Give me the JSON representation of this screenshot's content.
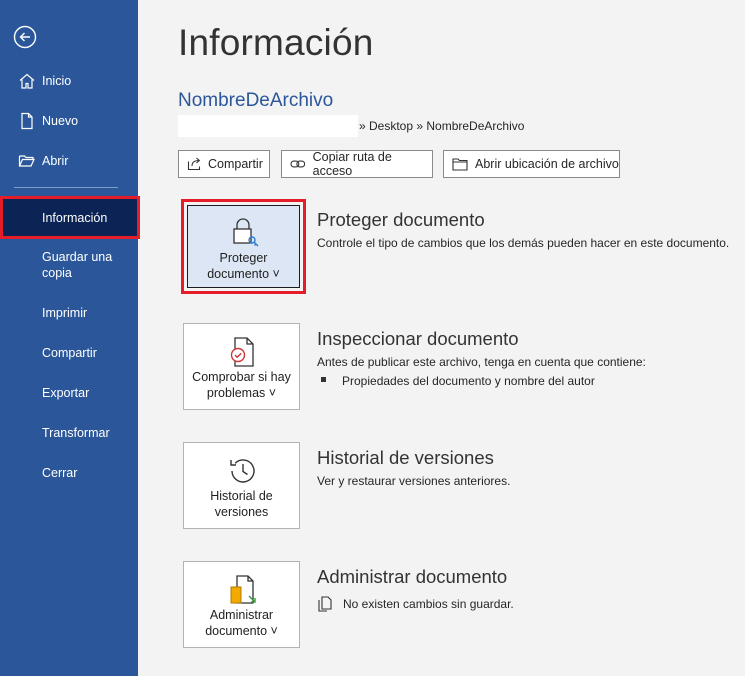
{
  "sidebar": {
    "items": [
      {
        "label": "Inicio",
        "icon": "home-icon"
      },
      {
        "label": "Nuevo",
        "icon": "new-document-icon"
      },
      {
        "label": "Abrir",
        "icon": "open-folder-icon"
      },
      {
        "label": "Información",
        "active": true
      },
      {
        "label": "Guardar una copia"
      },
      {
        "label": "Imprimir"
      },
      {
        "label": "Compartir"
      },
      {
        "label": "Exportar"
      },
      {
        "label": "Transformar"
      },
      {
        "label": "Cerrar"
      }
    ],
    "accent_color": "#2b579a",
    "active_color": "#0b2455",
    "highlight_color": "#e51d29"
  },
  "main": {
    "title": "Información",
    "file_name": "NombreDeArchivo",
    "path": "» Desktop » NombreDeArchivo",
    "actions": [
      {
        "label": "Compartir",
        "icon": "share-icon"
      },
      {
        "label": "Copiar ruta de acceso",
        "icon": "link-icon"
      },
      {
        "label": "Abrir ubicación de archivo",
        "icon": "folder-icon"
      }
    ],
    "sections": [
      {
        "card_label": "Proteger documento ˅",
        "card_icon": "lock-icon",
        "title": "Proteger documento",
        "description": "Controle el tipo de cambios que los demás pueden hacer en este documento."
      },
      {
        "card_label": "Comprobar si hay problemas ˅",
        "card_icon": "inspect-document-icon",
        "title": "Inspeccionar documento",
        "description": "Antes de publicar este archivo, tenga en cuenta que contiene:",
        "bullet": "Propiedades del documento y nombre del autor"
      },
      {
        "card_label": "Historial de versiones",
        "card_icon": "history-icon",
        "title": "Historial de versiones",
        "description": "Ver y restaurar versiones anteriores."
      },
      {
        "card_label": "Administrar documento ˅",
        "card_icon": "manage-document-icon",
        "title": "Administrar documento",
        "description": "No existen cambios sin guardar."
      }
    ]
  }
}
